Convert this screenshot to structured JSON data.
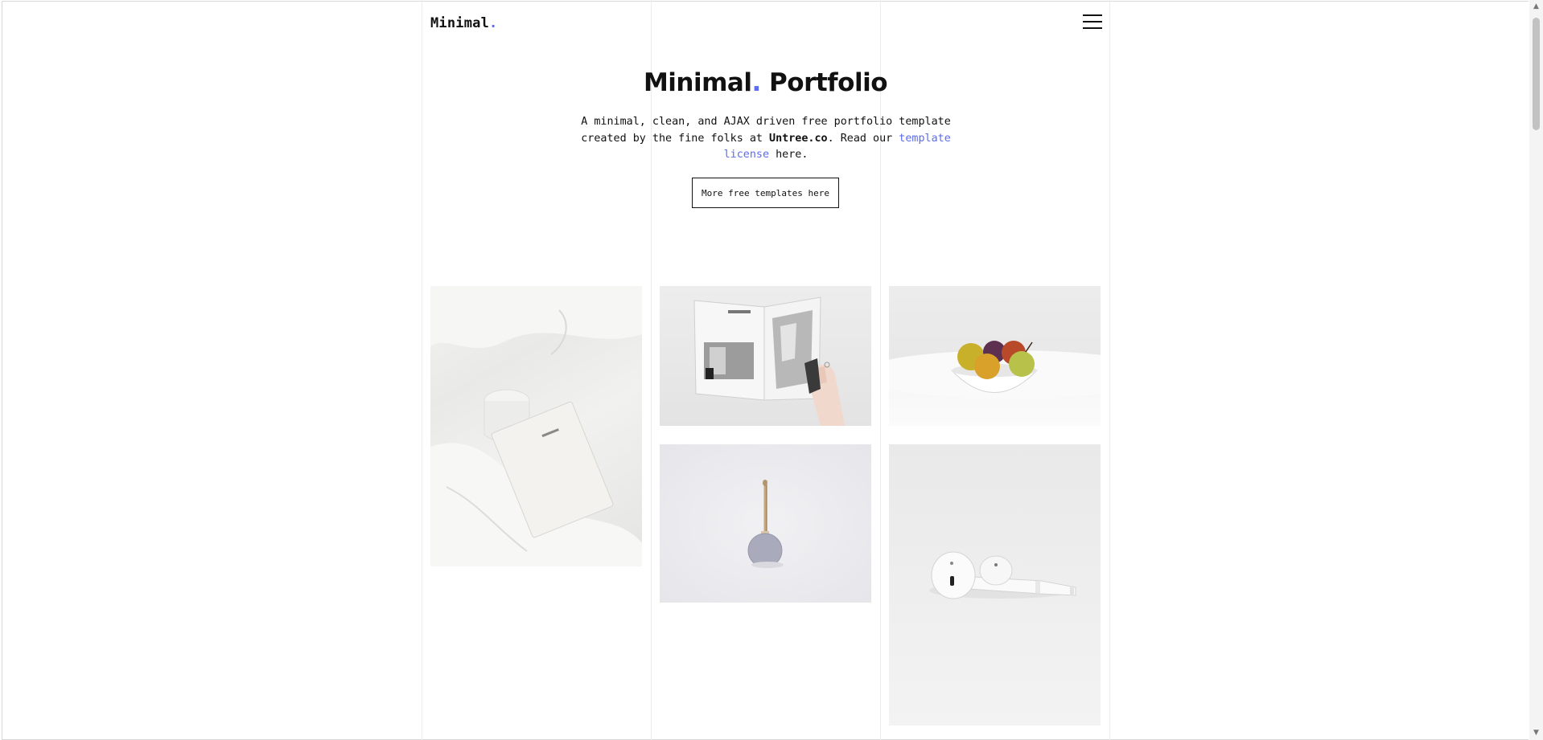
{
  "header": {
    "logo_text": "Minimal",
    "logo_dot": ".",
    "menu_icon": "hamburger-menu-icon"
  },
  "hero": {
    "title_part1": "Minimal",
    "title_dot": ".",
    "title_part2": " Portfolio",
    "desc_part1": "A minimal, clean, and AJAX driven free portfolio template created by the fine folks at ",
    "desc_brand": "Untree.co",
    "desc_part2": ". Read our ",
    "desc_link": "template license",
    "desc_part3": " here.",
    "cta_label": "More free templates here"
  },
  "portfolio": {
    "items": [
      {
        "subject": "bed-notebook-image"
      },
      {
        "subject": "magazine-image"
      },
      {
        "subject": "fruit-bowl-image"
      },
      {
        "subject": "speaker-image"
      },
      {
        "subject": "earbuds-image"
      }
    ]
  },
  "colors": {
    "accent": "#5b6cf0",
    "text": "#111111",
    "background": "#ffffff"
  }
}
